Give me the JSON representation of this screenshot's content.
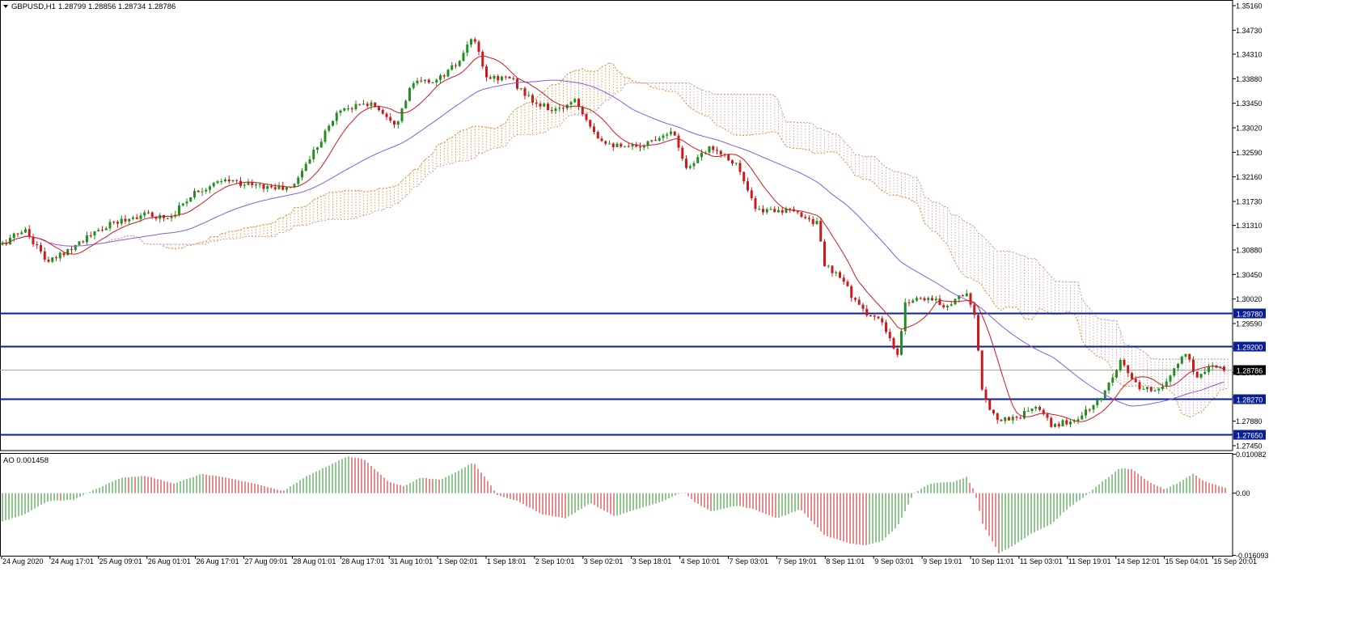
{
  "chart_data": {
    "type": "candlestick",
    "header": {
      "symbol": "GBPUSD,H1",
      "ohlc": "1.28799 1.28856 1.28734 1.28786"
    },
    "price_axis": {
      "labels": [
        "1.35160",
        "1.34730",
        "1.34310",
        "1.33880",
        "1.33450",
        "1.33020",
        "1.32590",
        "1.32160",
        "1.31730",
        "1.31310",
        "1.30880",
        "1.30450",
        "1.30020",
        "1.29590",
        "1.29160",
        "1.28730",
        "1.28300",
        "1.27880",
        "1.27450"
      ],
      "range": [
        1.27365,
        1.35245
      ]
    },
    "horizontal_levels": [
      {
        "value": 1.2978,
        "label": "1.29780",
        "color": "#0a1e96"
      },
      {
        "value": 1.292,
        "label": "1.29200",
        "color": "#0a1e96"
      },
      {
        "value": 1.2827,
        "label": "1.28270",
        "color": "#0a1e96"
      },
      {
        "value": 1.2765,
        "label": "1.27650",
        "color": "#0a1e96"
      }
    ],
    "current_price": {
      "value": 1.28786,
      "label": "1.28786"
    },
    "time_axis": [
      "24 Aug 2020",
      "24 Aug 17:01",
      "25 Aug 09:01",
      "26 Aug 01:01",
      "26 Aug 17:01",
      "27 Aug 09:01",
      "28 Aug 01:01",
      "28 Aug 17:01",
      "31 Aug 10:01",
      "1 Sep 02:01",
      "1 Sep 18:01",
      "2 Sep 10:01",
      "3 Sep 02:01",
      "3 Sep 18:01",
      "4 Sep 10:01",
      "7 Sep 03:01",
      "7 Sep 19:01",
      "8 Sep 11:01",
      "9 Sep 03:01",
      "9 Sep 19:01",
      "10 Sep 11:01",
      "11 Sep 03:01",
      "11 Sep 19:01",
      "14 Sep 12:01",
      "15 Sep 04:01",
      "15 Sep 20:01"
    ],
    "price_path_keypoints": [
      [
        0,
        1.3095
      ],
      [
        30,
        1.3125
      ],
      [
        60,
        1.3065
      ],
      [
        95,
        1.31
      ],
      [
        140,
        1.3135
      ],
      [
        175,
        1.315
      ],
      [
        210,
        1.3145
      ],
      [
        240,
        1.319
      ],
      [
        280,
        1.321
      ],
      [
        320,
        1.32
      ],
      [
        360,
        1.3195
      ],
      [
        385,
        1.3255
      ],
      [
        420,
        1.3335
      ],
      [
        460,
        1.3345
      ],
      [
        490,
        1.331
      ],
      [
        510,
        1.338
      ],
      [
        540,
        1.3385
      ],
      [
        570,
        1.342
      ],
      [
        585,
        1.3465
      ],
      [
        600,
        1.339
      ],
      [
        630,
        1.339
      ],
      [
        660,
        1.3345
      ],
      [
        690,
        1.333
      ],
      [
        710,
        1.3355
      ],
      [
        740,
        1.3285
      ],
      [
        770,
        1.3265
      ],
      [
        800,
        1.3275
      ],
      [
        830,
        1.33
      ],
      [
        850,
        1.323
      ],
      [
        880,
        1.327
      ],
      [
        910,
        1.324
      ],
      [
        935,
        1.3155
      ],
      [
        960,
        1.316
      ],
      [
        990,
        1.315
      ],
      [
        1010,
        1.3135
      ],
      [
        1020,
        1.306
      ],
      [
        1045,
        1.303
      ],
      [
        1060,
        1.299
      ],
      [
        1090,
        1.296
      ],
      [
        1110,
        1.29
      ],
      [
        1120,
        1.3
      ],
      [
        1145,
        1.3005
      ],
      [
        1170,
        1.299
      ],
      [
        1195,
        1.3015
      ],
      [
        1205,
        1.297
      ],
      [
        1215,
        1.283
      ],
      [
        1235,
        1.279
      ],
      [
        1260,
        1.2795
      ],
      [
        1280,
        1.2815
      ],
      [
        1300,
        1.278
      ],
      [
        1330,
        1.279
      ],
      [
        1360,
        1.2825
      ],
      [
        1385,
        1.2895
      ],
      [
        1410,
        1.284
      ],
      [
        1440,
        1.285
      ],
      [
        1465,
        1.291
      ],
      [
        1480,
        1.2865
      ],
      [
        1500,
        1.289
      ],
      [
        1515,
        1.2879
      ]
    ],
    "indicators": [
      {
        "name": "MA fast",
        "color": "#cc1a1a"
      },
      {
        "name": "MA slow",
        "color": "#8a5ad8"
      },
      {
        "name": "Ichimoku cloud",
        "colors": [
          "#e08a30",
          "#c89aa8"
        ]
      }
    ],
    "ao": {
      "label": "AO 0.001458",
      "axis_labels": [
        "0.010082",
        "0.00",
        "-0.016093"
      ],
      "range": [
        -0.0162,
        0.0102
      ],
      "keypoints": [
        [
          0,
          -0.0075
        ],
        [
          30,
          -0.0055
        ],
        [
          60,
          -0.002
        ],
        [
          90,
          -0.0018
        ],
        [
          120,
          0.0012
        ],
        [
          150,
          0.004
        ],
        [
          180,
          0.0045
        ],
        [
          215,
          0.0025
        ],
        [
          250,
          0.005
        ],
        [
          280,
          0.004
        ],
        [
          320,
          0.0022
        ],
        [
          350,
          0.0005
        ],
        [
          380,
          0.0045
        ],
        [
          410,
          0.0075
        ],
        [
          430,
          0.0095
        ],
        [
          450,
          0.0088
        ],
        [
          480,
          0.003
        ],
        [
          500,
          0.0018
        ],
        [
          520,
          0.004
        ],
        [
          545,
          0.0035
        ],
        [
          570,
          0.0062
        ],
        [
          585,
          0.008
        ],
        [
          600,
          0.004
        ],
        [
          615,
          -0.0005
        ],
        [
          640,
          -0.002
        ],
        [
          670,
          -0.0055
        ],
        [
          700,
          -0.0065
        ],
        [
          730,
          -0.0025
        ],
        [
          760,
          -0.006
        ],
        [
          790,
          -0.004
        ],
        [
          820,
          -0.002
        ],
        [
          845,
          0.0003
        ],
        [
          860,
          -0.0025
        ],
        [
          880,
          -0.0048
        ],
        [
          910,
          -0.0032
        ],
        [
          930,
          -0.004
        ],
        [
          960,
          -0.0065
        ],
        [
          990,
          -0.0042
        ],
        [
          1020,
          -0.011
        ],
        [
          1050,
          -0.013
        ],
        [
          1070,
          -0.0135
        ],
        [
          1090,
          -0.0125
        ],
        [
          1110,
          -0.0085
        ],
        [
          1130,
          0.0
        ],
        [
          1150,
          0.0025
        ],
        [
          1180,
          0.003
        ],
        [
          1195,
          0.0042
        ],
        [
          1205,
          0.0005
        ],
        [
          1215,
          -0.008
        ],
        [
          1235,
          -0.0155
        ],
        [
          1250,
          -0.014
        ],
        [
          1275,
          -0.0105
        ],
        [
          1300,
          -0.008
        ],
        [
          1320,
          -0.004
        ],
        [
          1340,
          -0.001
        ],
        [
          1360,
          0.0025
        ],
        [
          1385,
          0.0065
        ],
        [
          1400,
          0.0062
        ],
        [
          1420,
          0.003
        ],
        [
          1440,
          0.001
        ],
        [
          1460,
          0.003
        ],
        [
          1475,
          0.005
        ],
        [
          1490,
          0.003
        ],
        [
          1515,
          0.0014
        ]
      ]
    }
  }
}
